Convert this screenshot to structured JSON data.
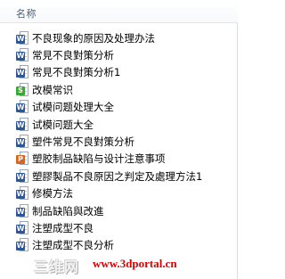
{
  "header": {
    "name_column": "名称"
  },
  "files": [
    {
      "name": "不良现象的原因及处理办法",
      "type": "word",
      "badge": "W",
      "color": "#2b5797"
    },
    {
      "name": "常見不良對策分析",
      "type": "word",
      "badge": "W",
      "color": "#2b5797"
    },
    {
      "name": "常見不良對策分析1",
      "type": "word",
      "badge": "W",
      "color": "#2b5797"
    },
    {
      "name": "改模常识",
      "type": "wps",
      "badge": "S",
      "color": "#3aa832"
    },
    {
      "name": "试模问题处理大全",
      "type": "word",
      "badge": "W",
      "color": "#2b5797"
    },
    {
      "name": "试模问题大全",
      "type": "word",
      "badge": "W",
      "color": "#2b5797"
    },
    {
      "name": "塑件常見不良對策分析",
      "type": "word",
      "badge": "W",
      "color": "#2b5797"
    },
    {
      "name": "塑胶制品缺陷与设计注意事项",
      "type": "powerpoint",
      "badge": "P",
      "color": "#d9661f"
    },
    {
      "name": "塑膠製品不良原因之判定及處理方法1",
      "type": "word",
      "badge": "W",
      "color": "#2b5797"
    },
    {
      "name": "修模方法",
      "type": "word",
      "badge": "W",
      "color": "#2b5797"
    },
    {
      "name": "制品缺陷與改進",
      "type": "word",
      "badge": "W",
      "color": "#2b5797"
    },
    {
      "name": "注塑成型不良",
      "type": "word",
      "badge": "W",
      "color": "#2b5797"
    },
    {
      "name": "注塑成型不良分析",
      "type": "word",
      "badge": "W",
      "color": "#2b5797"
    }
  ],
  "watermark": {
    "chinese": "三维网",
    "url": "www.3dportal.cn"
  }
}
